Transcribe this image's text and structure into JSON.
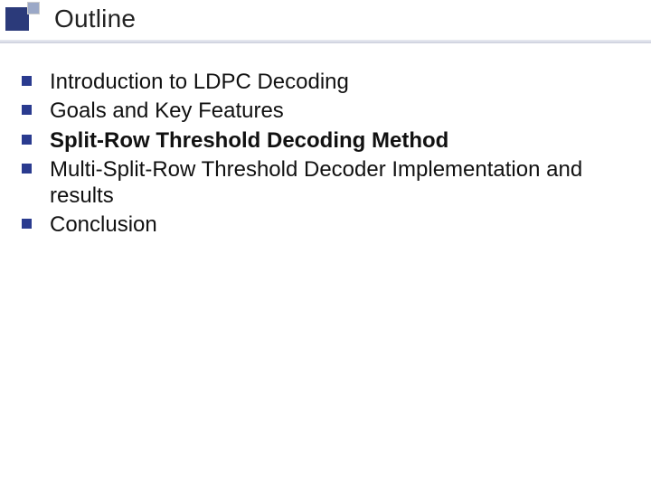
{
  "title": "Outline",
  "bullets": [
    {
      "text": "Introduction to LDPC Decoding",
      "bold": false
    },
    {
      "text": "Goals and Key Features",
      "bold": false
    },
    {
      "text": "Split-Row Threshold Decoding Method",
      "bold": true
    },
    {
      "text": "Multi-Split-Row Threshold Decoder Implementation and results",
      "bold": false
    },
    {
      "text": "Conclusion",
      "bold": false
    }
  ]
}
